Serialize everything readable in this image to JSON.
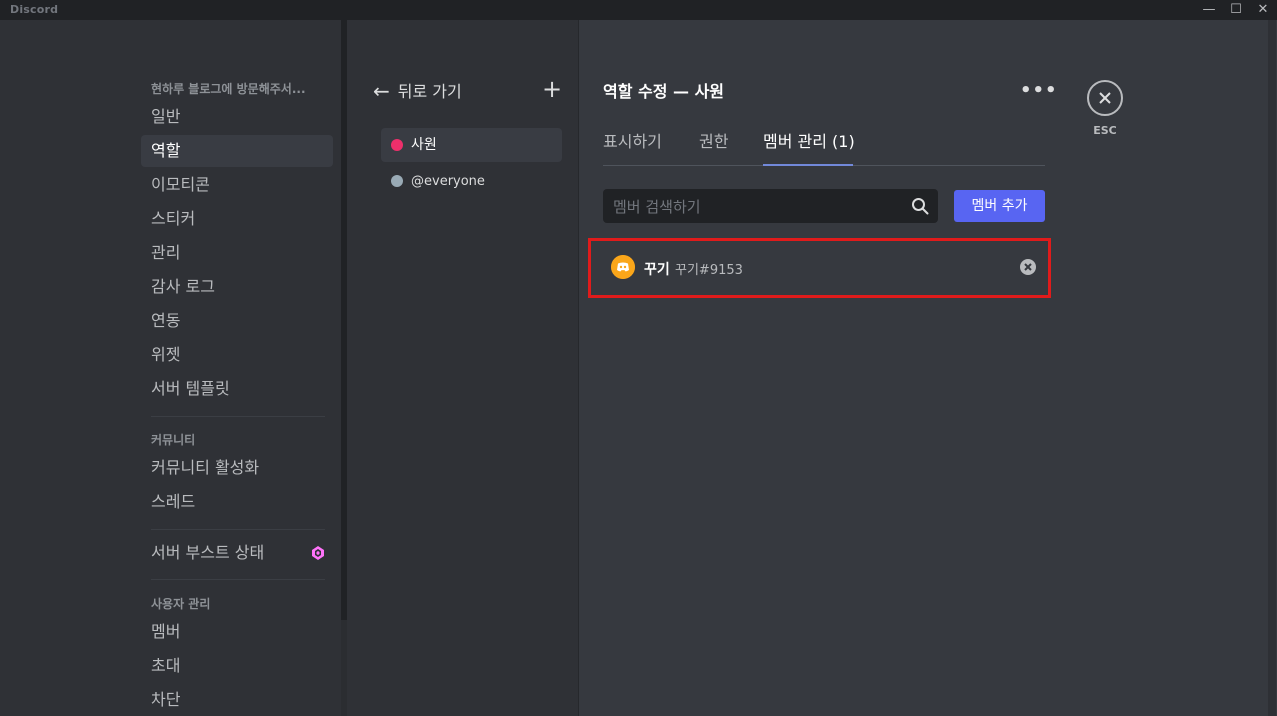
{
  "window": {
    "app_title": "Discord",
    "controls": [
      "minimize",
      "maximize",
      "close"
    ]
  },
  "sidebar": {
    "server_header": "현하루 블로그에 방문해주서...",
    "items": [
      {
        "label": "일반"
      },
      {
        "label": "역할",
        "active": true
      },
      {
        "label": "이모티콘"
      },
      {
        "label": "스티커"
      },
      {
        "label": "관리"
      },
      {
        "label": "감사 로그"
      },
      {
        "label": "연동"
      },
      {
        "label": "위젯"
      },
      {
        "label": "서버 템플릿"
      }
    ],
    "community_header": "커뮤니티",
    "community_items": [
      {
        "label": "커뮤니티 활성화"
      },
      {
        "label": "스레드"
      }
    ],
    "boost_item": {
      "label": "서버 부스트 상태",
      "icon": "boost-gem-icon",
      "icon_color": "#ff73fa"
    },
    "user_mgmt_header": "사용자 관리",
    "user_mgmt_items": [
      {
        "label": "멤버"
      },
      {
        "label": "초대"
      },
      {
        "label": "차단"
      }
    ]
  },
  "roles_panel": {
    "back_label": "뒤로 가기",
    "roles": [
      {
        "name": "사원",
        "color": "#ed2f6b",
        "active": true
      },
      {
        "name": "@everyone",
        "color": "#99aab5",
        "active": false
      }
    ]
  },
  "main": {
    "title": "역할 수정 — 사원",
    "tabs": [
      {
        "label": "표시하기"
      },
      {
        "label": "권한"
      },
      {
        "label": "멤버 관리 (1)",
        "active": true
      }
    ],
    "search_placeholder": "멤버 검색하기",
    "add_member_label": "멤버 추가",
    "members": [
      {
        "display_name": "꾸기",
        "tag": "꾸기#9153",
        "avatar_color": "#faa61a"
      }
    ],
    "close_label": "ESC"
  },
  "colors": {
    "accent": "#5865f2",
    "highlight_box": "#e01b1b",
    "tab_underline": "#7289da"
  }
}
